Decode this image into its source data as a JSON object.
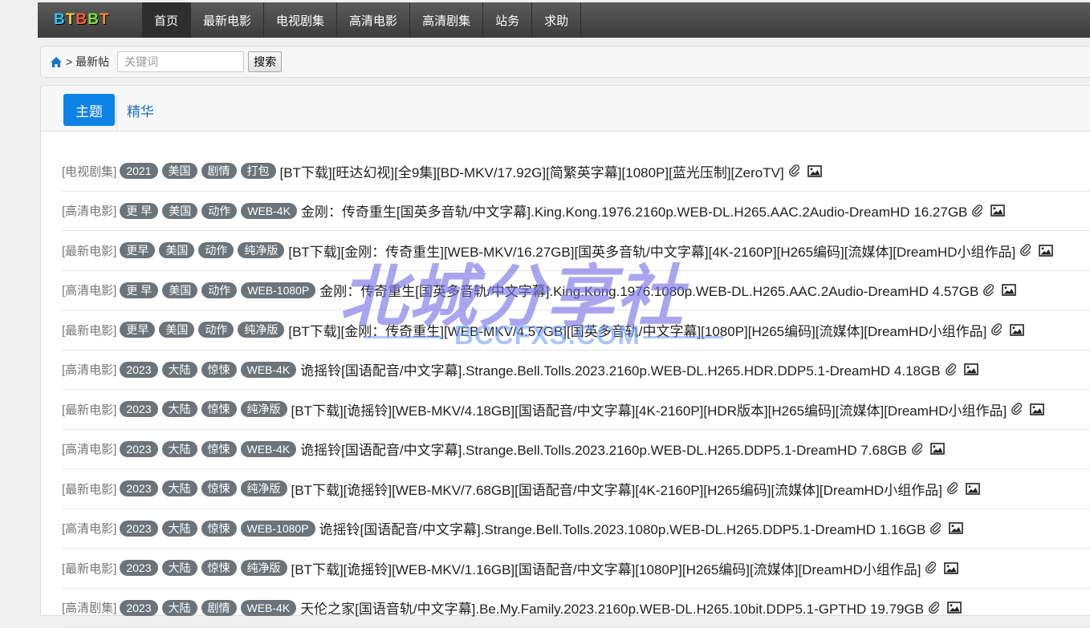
{
  "logo": {
    "text": "BTBBT"
  },
  "nav": [
    "首页",
    "最新电影",
    "电视剧集",
    "高清电影",
    "高清剧集",
    "站务",
    "求助"
  ],
  "breadcrumb": {
    "separator": ">",
    "current": "最新帖"
  },
  "search": {
    "placeholder": "关键词",
    "button": "搜索"
  },
  "tabs": {
    "active": "主题",
    "other": "精华"
  },
  "threads": [
    {
      "category": "[电视剧集]",
      "tags": [
        "2021",
        "美国",
        "剧情",
        "打包"
      ],
      "title": "[BT下载][旺达幻视][全9集][BD-MKV/17.92G][简繁英字幕][1080P][蓝光压制][ZeroTV]"
    },
    {
      "category": "[高清电影]",
      "tags": [
        "更 早",
        "美国",
        "动作",
        "WEB-4K"
      ],
      "title": "金刚：传奇重生[国英多音轨/中文字幕].King.Kong.1976.2160p.WEB-DL.H265.AAC.2Audio-DreamHD 16.27GB"
    },
    {
      "category": "[最新电影]",
      "tags": [
        "更早",
        "美国",
        "动作",
        "纯净版"
      ],
      "title": "[BT下载][金刚：传奇重生][WEB-MKV/16.27GB][国英多音轨/中文字幕][4K-2160P][H265编码][流媒体][DreamHD小组作品]"
    },
    {
      "category": "[高清电影]",
      "tags": [
        "更 早",
        "美国",
        "动作",
        "WEB-1080P"
      ],
      "title": "金刚：传奇重生[国英多音轨/中文字幕].King.Kong.1976.1080p.WEB-DL.H265.AAC.2Audio-DreamHD 4.57GB"
    },
    {
      "category": "[最新电影]",
      "tags": [
        "更早",
        "美国",
        "动作",
        "纯净版"
      ],
      "title": "[BT下载][金刚：传奇重生][WEB-MKV/4.57GB][国英多音轨/中文字幕][1080P][H265编码][流媒体][DreamHD小组作品]"
    },
    {
      "category": "[高清电影]",
      "tags": [
        "2023",
        "大陆",
        "惊悚",
        "WEB-4K"
      ],
      "title": "诡摇铃[国语配音/中文字幕].Strange.Bell.Tolls.2023.2160p.WEB-DL.H265.HDR.DDP5.1-DreamHD 4.18GB"
    },
    {
      "category": "[最新电影]",
      "tags": [
        "2023",
        "大陆",
        "惊悚",
        "纯净版"
      ],
      "title": "[BT下载][诡摇铃][WEB-MKV/4.18GB][国语配音/中文字幕][4K-2160P][HDR版本][H265编码][流媒体][DreamHD小组作品]"
    },
    {
      "category": "[高清电影]",
      "tags": [
        "2023",
        "大陆",
        "惊悚",
        "WEB-4K"
      ],
      "title": "诡摇铃[国语配音/中文字幕].Strange.Bell.Tolls.2023.2160p.WEB-DL.H265.DDP5.1-DreamHD 7.68GB"
    },
    {
      "category": "[最新电影]",
      "tags": [
        "2023",
        "大陆",
        "惊悚",
        "纯净版"
      ],
      "title": "[BT下载][诡摇铃][WEB-MKV/7.68GB][国语配音/中文字幕][4K-2160P][H265编码][流媒体][DreamHD小组作品]"
    },
    {
      "category": "[高清电影]",
      "tags": [
        "2023",
        "大陆",
        "惊悚",
        "WEB-1080P"
      ],
      "title": "诡摇铃[国语配音/中文字幕].Strange.Bell.Tolls.2023.1080p.WEB-DL.H265.DDP5.1-DreamHD 1.16GB"
    },
    {
      "category": "[最新电影]",
      "tags": [
        "2023",
        "大陆",
        "惊悚",
        "纯净版"
      ],
      "title": "[BT下载][诡摇铃][WEB-MKV/1.16GB][国语配音/中文字幕][1080P][H265编码][流媒体][DreamHD小组作品]"
    },
    {
      "category": "[高清剧集]",
      "tags": [
        "2023",
        "大陆",
        "剧情",
        "WEB-4K"
      ],
      "title": "天伦之家[国语音轨/中文字幕].Be.My.Family.2023.2160p.WEB-DL.H265.10bit.DDP5.1-GPTHD 19.79GB"
    }
  ],
  "watermark": {
    "cn": "北城分享社",
    "en": "BCCFXS.COM"
  },
  "colors": {
    "accent": "#0d83e8",
    "tag": "#6c7379",
    "navbar": "#4a4a4a"
  },
  "icons": [
    "home-icon",
    "paperclip-icon",
    "image-icon"
  ]
}
